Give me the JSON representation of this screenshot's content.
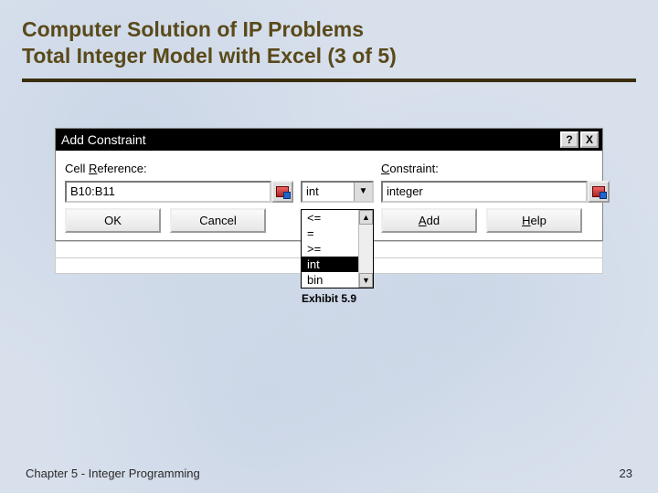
{
  "slide": {
    "title_line1": "Computer Solution of IP Problems",
    "title_line2": "Total Integer Model with Excel (3 of 5)",
    "exhibit_label": "Exhibit 5.9",
    "footer_left": "Chapter 5 - Integer Programming",
    "footer_right": "23"
  },
  "dialog": {
    "title": "Add Constraint",
    "labels": {
      "cell_reference": "Cell Reference:",
      "constraint": "Constraint:"
    },
    "fields": {
      "cell_reference_value": "B10:B11",
      "operator_value": "int",
      "constraint_value": "integer"
    },
    "operator_options": [
      "<=",
      "=",
      ">=",
      "int",
      "bin"
    ],
    "operator_selected_index": 3,
    "buttons": {
      "ok": "OK",
      "cancel": "Cancel",
      "add": "Add",
      "help": "Help"
    },
    "titlebar_icons": {
      "help": "?",
      "close": "X"
    }
  }
}
